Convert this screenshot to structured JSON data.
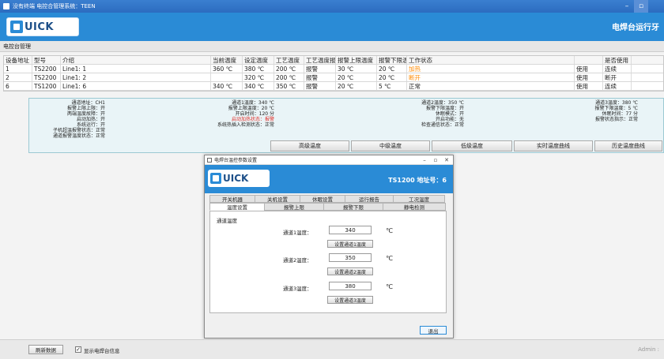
{
  "window": {
    "title": "没有终端 电控合管理系统：TEEN"
  },
  "header": {
    "logo_text": "UICK",
    "right_title": "电焊台运行牙"
  },
  "subhead": {
    "label": "电控台管理"
  },
  "grid": {
    "columns": [
      "设备地址",
      "型号",
      "介绍",
      "当前温度",
      "设定温度",
      "工艺温度",
      "工艺温度报警",
      "报警上限温度",
      "报警下限温度",
      "工作状态",
      "",
      "是否使用",
      "是否已!"
    ],
    "rows": [
      [
        "1",
        "TS2200",
        "Line1: 1",
        "360 ℃",
        "380 ℃",
        "200 ℃",
        "报警",
        "30 ℃",
        "20 ℃",
        "加热",
        "",
        "使用",
        "连续"
      ],
      [
        "2",
        "TS2200",
        "Line1: 2",
        "",
        "320 ℃",
        "200 ℃",
        "报警",
        "20 ℃",
        "20 ℃",
        "断开",
        "",
        "使用",
        "断开"
      ],
      [
        "6",
        "TS1200",
        "Line1: 6",
        "340 ℃",
        "340 ℃",
        "350 ℃",
        "报警",
        "20 ℃",
        "5 ℃",
        "正常",
        "",
        "使用",
        "连续"
      ]
    ]
  },
  "detail": {
    "col1": [
      "通道地址：CH1",
      "报警上限上限：开",
      "两端温度故障：开",
      "启动加热：开",
      "系统运行：开",
      "子机超温报警状态：正常",
      "通道报警温度状态：正常"
    ],
    "col2": [
      "通道1温度：340 ℃",
      "报警上限温度：20 ℃",
      "开启时间：120 分",
      "启动加热状态：报警",
      "系统热插入检测状态：正常"
    ],
    "col3": [
      "通道2温度：350 ℃",
      "报警下限温度：开",
      "休眠模式：开",
      "开启功能：无",
      "检查通信状态：正常"
    ],
    "col4": [
      "通道3温度：380 ℃",
      "报警下限温度：5 ℃",
      "休眠时间：77 分",
      "",
      "报警状态指示：正常"
    ],
    "buttons": [
      "高级温度",
      "中级温度",
      "低级温度",
      "实时温度曲线",
      "历史温度曲线"
    ]
  },
  "dialog": {
    "title": "电焊台温控参数设置",
    "logo_text": "UICK",
    "info": "TS1200  地址号：6",
    "tabs_row1": [
      "开关机器",
      "关机设置",
      "休眠设置",
      "运行报告",
      "工况温度"
    ],
    "tabs_row2": [
      "温度设置",
      "报警上限",
      "报警下限",
      "静电检测"
    ],
    "section_label": "通道温度",
    "channels": [
      {
        "label": "通道1温度：",
        "value": "340",
        "unit": "℃",
        "button": "设置通道1温度"
      },
      {
        "label": "通道2温度：",
        "value": "350",
        "unit": "℃",
        "button": "设置通道2温度"
      },
      {
        "label": "通道3温度：",
        "value": "380",
        "unit": "℃",
        "button": "设置通道3温度"
      }
    ],
    "exit_label": "退出"
  },
  "footer": {
    "button": "刷新数据",
    "check_label": "显示电焊台信息",
    "checked_mark": "✓",
    "user": "Admin :"
  },
  "colors": {
    "accent": "#2a8bd6",
    "warn": "#ff8a00",
    "alarm": "#e0302a"
  }
}
